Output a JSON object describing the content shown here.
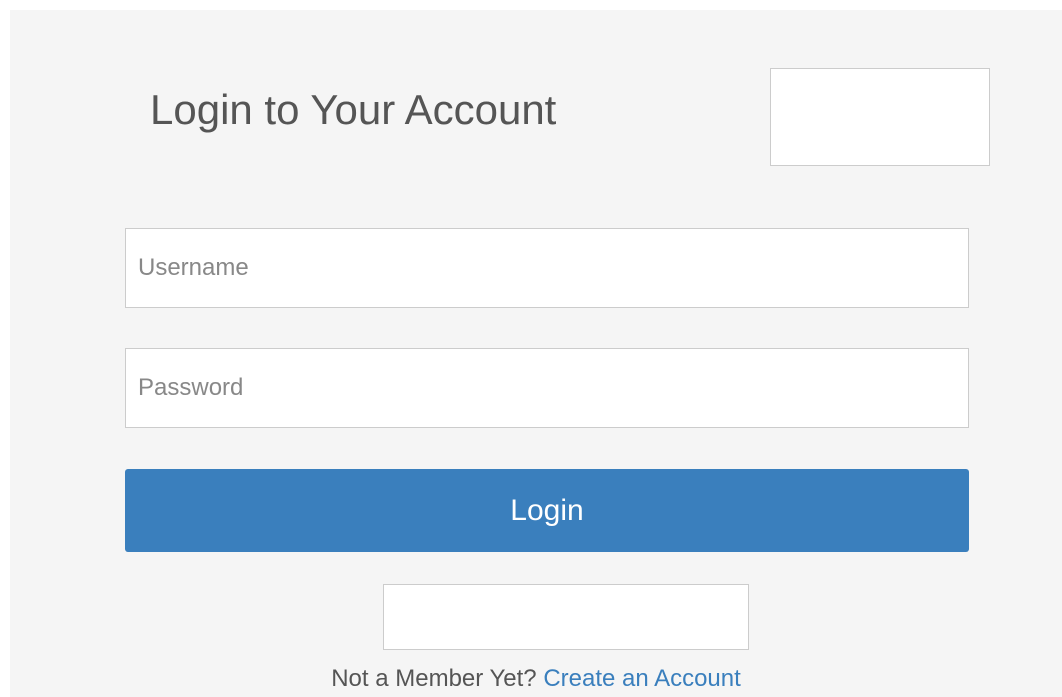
{
  "login_form": {
    "title": "Login to Your Account",
    "username": {
      "value": "",
      "placeholder": "Username"
    },
    "password": {
      "value": "",
      "placeholder": "Password"
    },
    "login_button_label": "Login",
    "signup_prompt": "Not a Member Yet?",
    "signup_link_label": "Create an Account"
  },
  "colors": {
    "panel_background": "#f5f5f5",
    "accent": "#3a7fbd",
    "text": "#555555",
    "field_border": "#cccccc"
  }
}
